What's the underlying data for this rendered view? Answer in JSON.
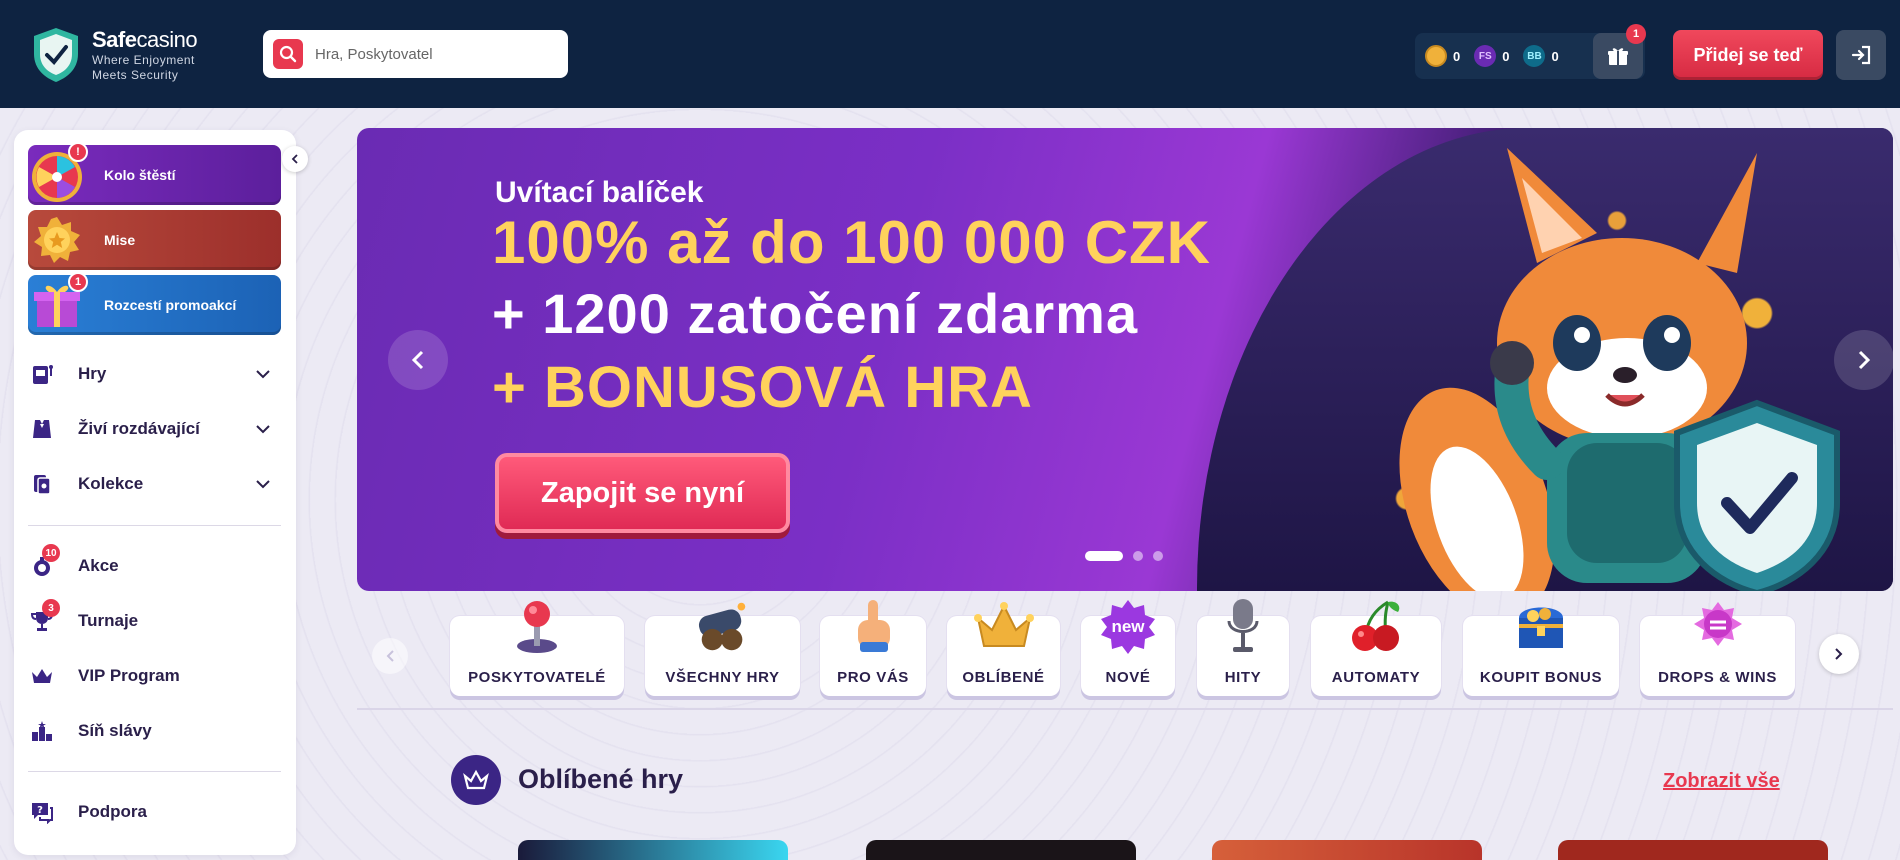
{
  "header": {
    "brand_bold": "Safe",
    "brand_light": "casino",
    "tagline_1": "Where Enjoyment",
    "tagline_2": "Meets Security",
    "search_placeholder": "Hra, Poskytovatel",
    "wallet": [
      {
        "code": "",
        "value": "0",
        "color": "#f0b13a"
      },
      {
        "code": "FS",
        "value": "0",
        "color": "#9b4de0"
      },
      {
        "code": "BB",
        "value": "0",
        "color": "#2bc2e0"
      }
    ],
    "gift_badge": "1",
    "join_label": "Přidej se teď"
  },
  "sidebar": {
    "promos": [
      {
        "label": "Kolo štěstí",
        "badge": "!"
      },
      {
        "label": "Mise",
        "badge": ""
      },
      {
        "label": "Rozcestí promoakcí",
        "badge": "1"
      }
    ],
    "menu": [
      {
        "label": "Hry"
      },
      {
        "label": "Živí rozdávající"
      },
      {
        "label": "Kolekce"
      }
    ],
    "links": [
      {
        "label": "Akce",
        "badge": "10"
      },
      {
        "label": "Turnaje",
        "badge": "3"
      },
      {
        "label": "VIP Program",
        "badge": ""
      },
      {
        "label": "Síň slávy",
        "badge": ""
      }
    ],
    "support": "Podpora"
  },
  "hero": {
    "subtitle": "Uvítací balíček",
    "line1": "100% až do 100 000 CZK",
    "line2": "+ 1200 zatočení zdarma",
    "line3": "+ BONUSOVÁ HRA",
    "cta": "Zapojit se nyní",
    "slides_total": 3,
    "active_slide": 1
  },
  "categories": [
    {
      "label": "POSKYTOVATELÉ",
      "icon": "joystick-icon"
    },
    {
      "label": "VŠECHNY HRY",
      "icon": "cannon-icon"
    },
    {
      "label": "PRO VÁS",
      "icon": "pointing-hand-icon"
    },
    {
      "label": "OBLÍBENÉ",
      "icon": "crown-icon"
    },
    {
      "label": "NOVÉ",
      "icon": "new-badge-icon"
    },
    {
      "label": "HITY",
      "icon": "microphone-icon"
    },
    {
      "label": "AUTOMATY",
      "icon": "cherry-icon"
    },
    {
      "label": "KOUPIT BONUS",
      "icon": "treasure-chest-icon"
    },
    {
      "label": "DROPS & WINS",
      "icon": "drops-wins-icon"
    }
  ],
  "new_badge_text": "new",
  "favorites": {
    "title": "Oblíbené hry",
    "view_all": "Zobrazit vše"
  },
  "colors": {
    "header_bg": "#0e2341",
    "accent_red": "#e8384f",
    "hero_yellow": "#ffd25c",
    "text_dark": "#2a1f4a"
  }
}
